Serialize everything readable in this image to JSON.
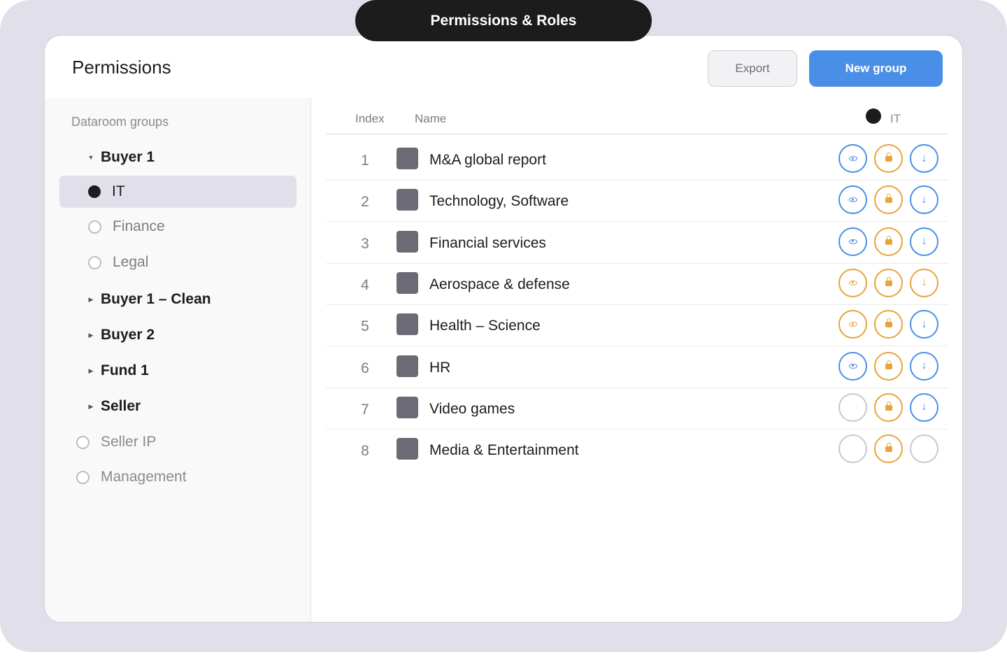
{
  "window_title": "Permissions & Roles",
  "header": {
    "title": "Permissions",
    "export_label": "Export",
    "new_group_label": "New group"
  },
  "sidebar": {
    "heading": "Dataroom groups",
    "items": [
      {
        "label": "Buyer 1",
        "kind": "group",
        "expanded": true
      },
      {
        "label": "IT",
        "kind": "child",
        "selected": true
      },
      {
        "label": "Finance",
        "kind": "child",
        "selected": false
      },
      {
        "label": "Legal",
        "kind": "child",
        "selected": false
      },
      {
        "label": "Buyer 1 – Clean",
        "kind": "group",
        "expanded": false
      },
      {
        "label": "Buyer 2",
        "kind": "group",
        "expanded": false
      },
      {
        "label": "Fund 1",
        "kind": "group",
        "expanded": false
      },
      {
        "label": "Seller",
        "kind": "group",
        "expanded": false
      },
      {
        "label": "Seller IP",
        "kind": "top",
        "selected": false
      },
      {
        "label": "Management",
        "kind": "top",
        "selected": false
      }
    ]
  },
  "table": {
    "columns": {
      "index": "Index",
      "name": "Name",
      "group": "IT"
    },
    "rows": [
      {
        "index": "1",
        "name": "M&A global report",
        "view": "blue",
        "lock": "orange",
        "download": "blue"
      },
      {
        "index": "2",
        "name": "Technology, Software",
        "view": "blue",
        "lock": "orange",
        "download": "blue"
      },
      {
        "index": "3",
        "name": "Financial services",
        "view": "blue",
        "lock": "orange",
        "download": "blue"
      },
      {
        "index": "4",
        "name": "Aerospace & defense",
        "view": "orange",
        "lock": "orange",
        "download": "orange"
      },
      {
        "index": "5",
        "name": "Health – Science",
        "view": "orange",
        "lock": "orange",
        "download": "blue"
      },
      {
        "index": "6",
        "name": "HR",
        "view": "blue",
        "lock": "orange",
        "download": "blue"
      },
      {
        "index": "7",
        "name": "Video games",
        "view": "empty",
        "lock": "orange",
        "download": "blue"
      },
      {
        "index": "8",
        "name": "Media & Entertainment",
        "view": "empty",
        "lock": "orange",
        "download": "empty"
      }
    ]
  },
  "colors": {
    "accent_blue": "#4a8fe7",
    "accent_orange": "#e8a33d",
    "frame_bg": "#e1e0ea",
    "dark": "#1c1c1c"
  },
  "icons": {
    "view": "eye-icon",
    "lock": "lock-icon",
    "download": "download-arrow-icon",
    "folder": "folder-icon",
    "caret_expanded": "caret-down-icon",
    "caret_collapsed": "caret-right-icon"
  }
}
